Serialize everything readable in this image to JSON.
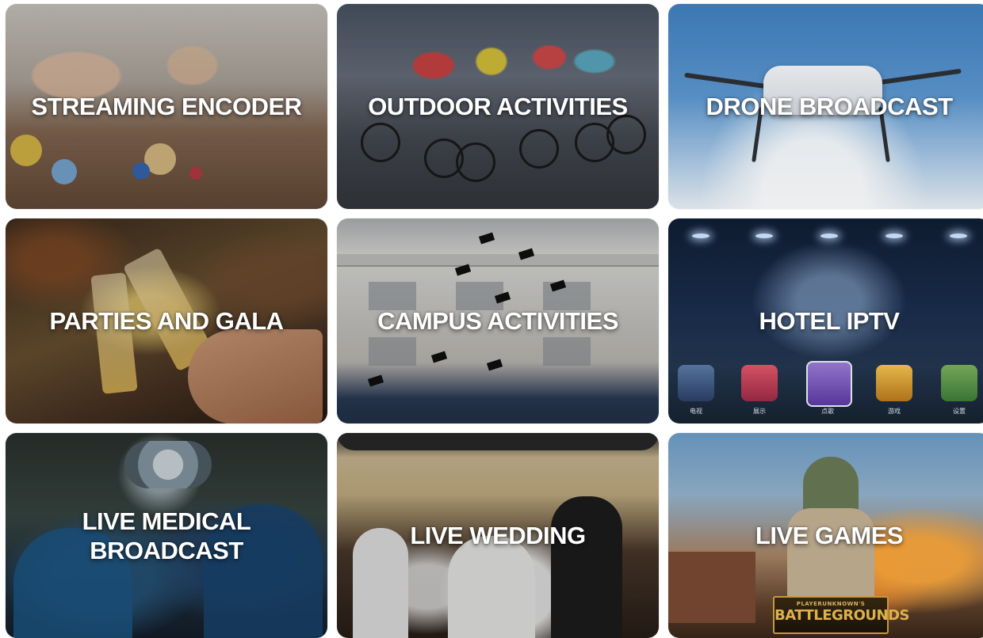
{
  "tiles": [
    {
      "id": "streaming-encoder",
      "label": "STREAMING ENCODER"
    },
    {
      "id": "outdoor-activities",
      "label": "OUTDOOR ACTIVITIES"
    },
    {
      "id": "drone-broadcast",
      "label": "DRONE BROADCAST"
    },
    {
      "id": "parties-and-gala",
      "label": "PARTIES AND GALA"
    },
    {
      "id": "campus-activities",
      "label": "CAMPUS ACTIVITIES"
    },
    {
      "id": "hotel-iptv",
      "label": "HOTEL IPTV"
    },
    {
      "id": "live-medical-broadcast",
      "label": "LIVE MEDICAL\nBROADCAST"
    },
    {
      "id": "live-wedding",
      "label": "LIVE WEDDING"
    },
    {
      "id": "live-games",
      "label": "LIVE GAMES"
    }
  ],
  "hotel_menu": {
    "items": [
      "电视",
      "展示",
      "点歌",
      "游戏",
      "设置"
    ]
  },
  "game_logo": {
    "top": "PLAYERUNKNOWN'S",
    "main": "BATTLEGROUNDS"
  },
  "colors": {
    "label_text": "#ffffff",
    "page_background": "#ffffff"
  }
}
